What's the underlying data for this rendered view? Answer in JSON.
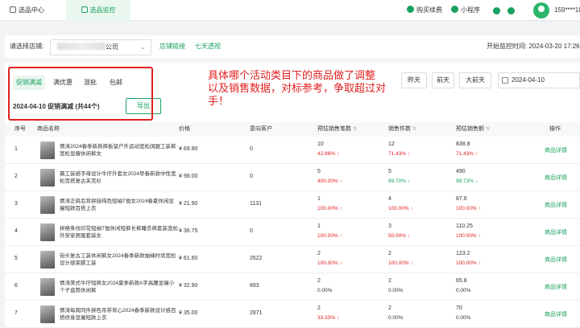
{
  "topbar": {
    "tab_home": "选品中心",
    "tab_monitor": "选品监控",
    "buy": "购买续费",
    "mini": "小程序",
    "user": "159****18"
  },
  "filter": {
    "store_label": "请选择店铺:",
    "store_suffix": "公司",
    "link1": "店铺链接",
    "link2": "七天透视",
    "start_label": "开始监控时间:",
    "start_value": "2024-03-20 17:26"
  },
  "tabs": [
    "促销满减",
    "满优惠",
    "混批",
    "包邮"
  ],
  "summary": "2024-04-10 促销满减 (共44个)",
  "export": "导出",
  "annotation": [
    "具体哪个活动类目下的商品做了调整",
    "以及销售数据，对标参考，争取超过对手！"
  ],
  "date_buttons": [
    "昨天",
    "前天",
    "大前天"
  ],
  "date_value": "2024-04-10",
  "table": {
    "headers": [
      "序号",
      "商品名称",
      "价格",
      "意向客户",
      "预估销售笔数",
      "销售件数",
      "预估销售额",
      "操作"
    ],
    "rows": [
      {
        "no": "1",
        "name": "情涛2024春季新款裤板留户外运动宽松阔腿工装裤宽松显瘦休闲裤女",
        "price": "¥ 69.90",
        "cust": "0",
        "orders": "10",
        "orders_pct": "42.86%",
        "orders_dir": "up",
        "pieces": "12",
        "pieces_pct": "71.43%",
        "pieces_dir": "up",
        "sales": "838.8",
        "sales_pct": "71.43%",
        "sales_dir": "up",
        "op": "商品详情"
      },
      {
        "no": "2",
        "name": "晨工装感字母设计牛仔外套女2024早春新款中性宽松百搭复古夹克衫",
        "price": "¥ 98.00",
        "cust": "0",
        "orders": "5",
        "orders_pct": "400.00%",
        "orders_dir": "up",
        "pieces": "5",
        "pieces_pct": "99.70%",
        "pieces_dir": "down",
        "sales": "490",
        "sales_pct": "99.73%",
        "sales_dir": "down",
        "op": "商品详情"
      },
      {
        "no": "3",
        "name": "情涛正肩后背拼接纯色短袖T恤女2024春夏休闲显瘦短款百搭上衣",
        "price": "¥ 21.90",
        "cust": "1131",
        "orders": "1",
        "orders_pct": "100.00%",
        "orders_dir": "up",
        "pieces": "4",
        "pieces_pct": "100.00%",
        "pieces_dir": "up",
        "sales": "87.6",
        "sales_pct": "100.00%",
        "sales_dir": "up",
        "op": "商品详情"
      },
      {
        "no": "4",
        "name": "拼格条纹印花短袖T恤休闲短裤长裤睡衣裤套装宽松外穿家居服套装女",
        "price": "¥ 36.75",
        "cust": "0",
        "orders": "1",
        "orders_pct": "100.00%",
        "orders_dir": "up",
        "pieces": "3",
        "pieces_pct": "50.00%",
        "pieces_dir": "up",
        "sales": "110.25",
        "sales_pct": "100.00%",
        "sales_dir": "up",
        "op": "商品详情"
      },
      {
        "no": "5",
        "name": "街头复古工装休闲裤女2024春季新款抽绳时尚宽松设计感束脚工装",
        "price": "¥ 61.60",
        "cust": "2622",
        "orders": "2",
        "orders_pct": "100.00%",
        "orders_dir": "up",
        "pieces": "2",
        "pieces_pct": "100.00%",
        "pieces_dir": "up",
        "sales": "123.2",
        "sales_pct": "100.00%",
        "sales_dir": "up",
        "op": "商品详情"
      },
      {
        "no": "6",
        "name": "情涛美式牛仔短裤女2024夏季新款A字高腰显瘦小个子直筒休闲裤",
        "price": "¥ 32.90",
        "cust": "893",
        "orders": "2",
        "orders_pct": "0.00%",
        "orders_dir": "",
        "pieces": "2",
        "pieces_pct": "0.00%",
        "pieces_dir": "",
        "sales": "65.8",
        "sales_pct": "0.00%",
        "sales_dir": "",
        "op": "商品详情"
      },
      {
        "no": "7",
        "name": "情涛每周同件拼色吊带背心2024春季新款设计感百搭修身显瘦短款上衣",
        "price": "¥ 35.00",
        "cust": "2871",
        "orders": "2",
        "orders_pct": "33.33%",
        "orders_dir": "up",
        "pieces": "2",
        "pieces_pct": "0.00%",
        "pieces_dir": "",
        "sales": "70",
        "sales_pct": "0.00%",
        "sales_dir": "",
        "op": "商品详情"
      }
    ]
  },
  "colors": {
    "accent": "#19a15f",
    "alert": "#e02020"
  }
}
